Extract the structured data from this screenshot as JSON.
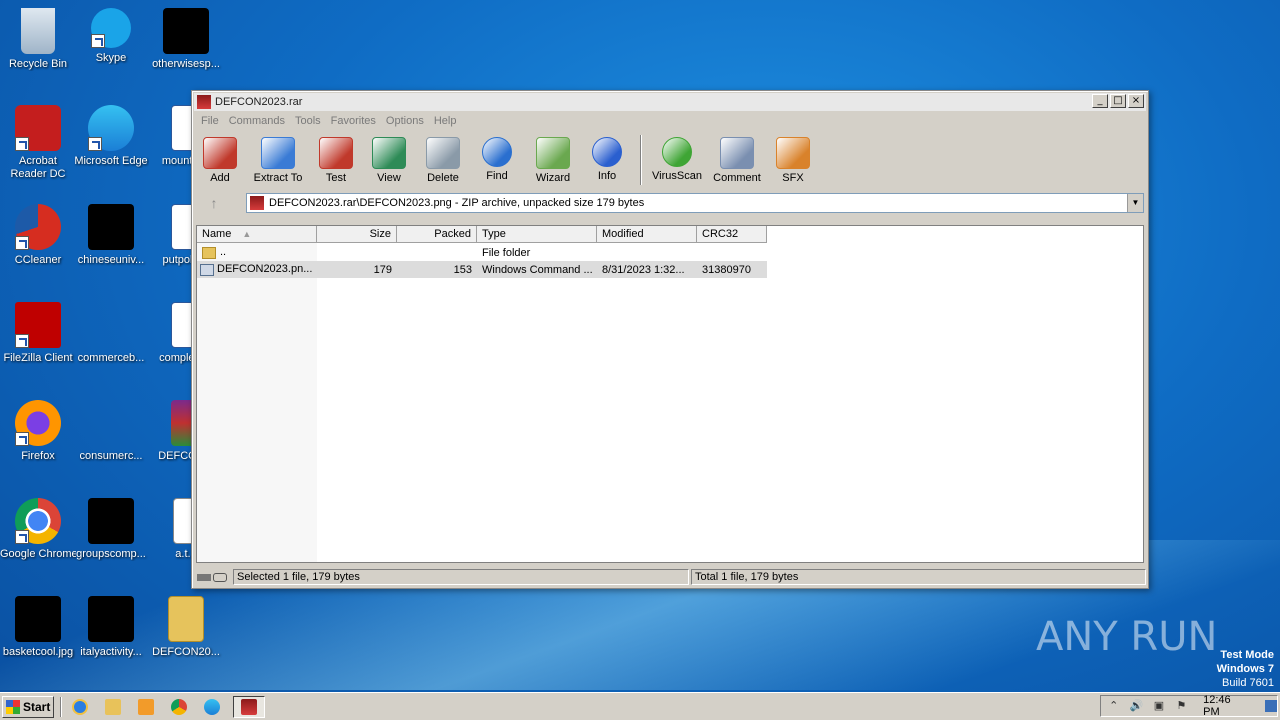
{
  "desktop": {
    "icons": [
      {
        "label": "Recycle Bin",
        "icon": "recycle-bin-icon"
      },
      {
        "label": "Skype",
        "icon": "skype-icon"
      },
      {
        "label": "otherwisesp...",
        "icon": "black-thumbnail-icon"
      },
      {
        "label": "Acrobat Reader DC",
        "icon": "acrobat-icon"
      },
      {
        "label": "Microsoft Edge",
        "icon": "edge-icon"
      },
      {
        "label": "mountai...",
        "icon": "word-doc-icon"
      },
      {
        "label": "CCleaner",
        "icon": "ccleaner-icon"
      },
      {
        "label": "chineseuniv...",
        "icon": "black-thumbnail-icon"
      },
      {
        "label": "putpoliti...",
        "icon": "word-doc-icon"
      },
      {
        "label": "FileZilla Client",
        "icon": "filezilla-icon"
      },
      {
        "label": "commerceb...",
        "icon": "blank-icon"
      },
      {
        "label": "complete...",
        "icon": "word-doc-icon"
      },
      {
        "label": "Firefox",
        "icon": "firefox-icon"
      },
      {
        "label": "consumerc...",
        "icon": "blank-icon"
      },
      {
        "label": "DEFCON...",
        "icon": "winrar-archive-icon"
      },
      {
        "label": "Google Chrome",
        "icon": "chrome-icon"
      },
      {
        "label": "groupscomp...",
        "icon": "black-thumbnail-icon"
      },
      {
        "label": "a.t...",
        "icon": "text-file-icon"
      },
      {
        "label": "basketcool.jpg",
        "icon": "black-thumbnail-icon"
      },
      {
        "label": "italyactivity...",
        "icon": "black-thumbnail-icon"
      },
      {
        "label": "DEFCON20...",
        "icon": "folder-icon"
      }
    ]
  },
  "window": {
    "title": "DEFCON2023.rar",
    "menu": [
      "File",
      "Commands",
      "Tools",
      "Favorites",
      "Options",
      "Help"
    ],
    "toolbar": [
      {
        "label": "Add",
        "icon": "add-archive-icon",
        "color": "#c0392b"
      },
      {
        "label": "Extract To",
        "icon": "extract-folder-icon",
        "color": "#3a7bd5"
      },
      {
        "label": "Test",
        "icon": "test-clipboard-icon",
        "color": "#c0392b"
      },
      {
        "label": "View",
        "icon": "view-book-icon",
        "color": "#2e8b57"
      },
      {
        "label": "Delete",
        "icon": "delete-trash-icon",
        "color": "#8a9aa8"
      },
      {
        "label": "Find",
        "icon": "find-magnifier-icon",
        "color": "#2a6fcf"
      },
      {
        "label": "Wizard",
        "icon": "wizard-wand-icon",
        "color": "#6aa84f"
      },
      {
        "label": "Info",
        "icon": "info-icon",
        "color": "#2a5fcf"
      },
      {
        "label": "VirusScan",
        "icon": "virus-scan-icon",
        "color": "#3fa535"
      },
      {
        "label": "Comment",
        "icon": "comment-icon",
        "color": "#7a8fb0"
      },
      {
        "label": "SFX",
        "icon": "sfx-box-icon",
        "color": "#d9822b"
      }
    ],
    "address": "DEFCON2023.rar\\DEFCON2023.png  - ZIP archive, unpacked size 179 bytes",
    "columns": [
      "Name",
      "Size",
      "Packed",
      "Type",
      "Modified",
      "CRC32"
    ],
    "rows": [
      {
        "name": "..",
        "size": "",
        "packed": "",
        "type": "File folder",
        "modified": "",
        "crc": ""
      },
      {
        "name": "DEFCON2023.pn...",
        "size": "179",
        "packed": "153",
        "type": "Windows Command ...",
        "modified": "8/31/2023 1:32...",
        "crc": "31380970"
      }
    ],
    "status_left": "Selected 1 file, 179 bytes",
    "status_right": "Total 1 file, 179 bytes"
  },
  "watermark": {
    "brand": "ANY RUN",
    "test_mode": "Test Mode",
    "os": "Windows 7",
    "build": "Build 7601"
  },
  "taskbar": {
    "start_label": "Start",
    "apps": [
      "ie-icon",
      "explorer-icon",
      "media-player-icon",
      "chrome-icon",
      "edge-icon",
      "winrar-icon"
    ],
    "clock": "12:46 PM"
  }
}
